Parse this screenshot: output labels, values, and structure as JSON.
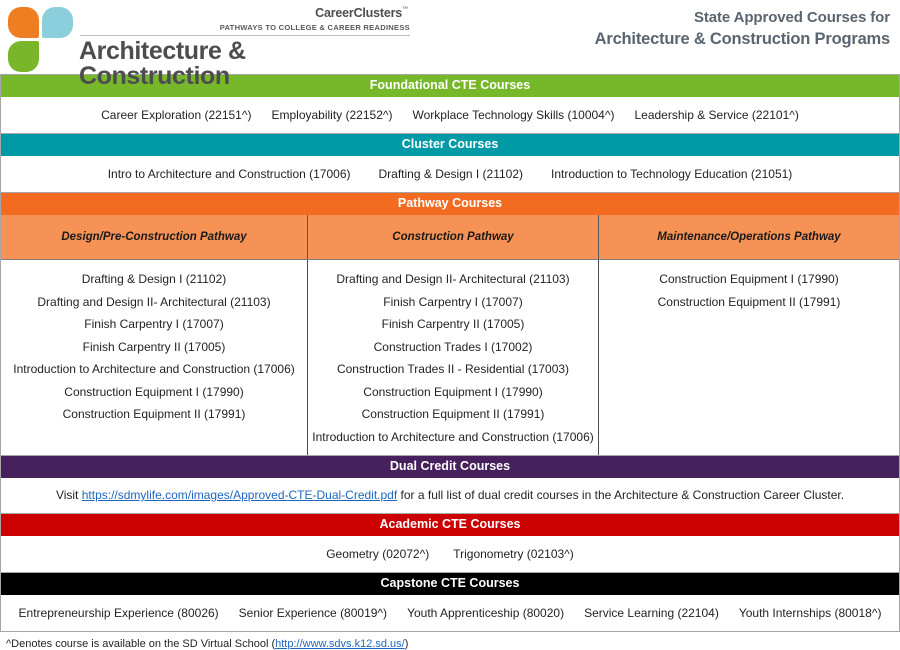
{
  "header": {
    "brand_name": "CareerClusters",
    "brand_tm": "™",
    "brand_tagline": "PATHWAYS TO COLLEGE & CAREER READINESS",
    "cluster_line1": "Architecture &",
    "cluster_line2": "Construction",
    "title_line1": "State Approved Courses for",
    "title_line2": "Architecture & Construction Programs",
    "logo_colors": {
      "orange": "#ef7d22",
      "light_blue": "#8ccfdc",
      "green": "#7ab629"
    }
  },
  "sections": {
    "foundational": {
      "title": "Foundational CTE Courses",
      "color": "#76b82a",
      "courses": [
        "Career Exploration (22151^)",
        "Employability (22152^)",
        "Workplace Technology Skills (10004^)",
        "Leadership & Service (22101^)"
      ]
    },
    "cluster": {
      "title": "Cluster Courses",
      "color": "#009aa6",
      "courses": [
        "Intro to Architecture and Construction (17006)",
        "Drafting & Design I (21102)",
        "Introduction to Technology Education (21051)"
      ]
    },
    "pathway": {
      "title": "Pathway Courses",
      "color": "#f26b21",
      "subheader_color": "#f79256",
      "columns": [
        {
          "label": "Design/Pre-Construction Pathway",
          "courses": [
            "Drafting & Design I (21102)",
            "Drafting and Design II- Architectural (21103)",
            "Finish Carpentry I (17007)",
            "Finish Carpentry II (17005)",
            "Introduction to Architecture and Construction (17006)",
            "Construction Equipment I (17990)",
            "Construction Equipment II (17991)"
          ]
        },
        {
          "label": "Construction Pathway",
          "courses": [
            "Drafting and Design II- Architectural (21103)",
            "Finish Carpentry I (17007)",
            "Finish Carpentry II (17005)",
            "Construction Trades I (17002)",
            "Construction Trades II - Residential (17003)",
            "Construction Equipment I (17990)",
            "Construction Equipment II (17991)",
            "Introduction to Architecture and Construction (17006)"
          ]
        },
        {
          "label": "Maintenance/Operations Pathway",
          "courses": [
            "Construction Equipment I (17990)",
            "Construction Equipment II (17991)"
          ]
        }
      ]
    },
    "dual_credit": {
      "title": "Dual Credit Courses",
      "color": "#46215e",
      "text_before": "Visit ",
      "link_text": "https://sdmylife.com/images/Approved-CTE-Dual-Credit.pdf",
      "text_after": " for a full list of dual credit courses in the Architecture & Construction Career Cluster."
    },
    "academic": {
      "title": "Academic CTE Courses",
      "color": "#cc0000",
      "courses": [
        "Geometry (02072^)",
        "Trigonometry (02103^)"
      ]
    },
    "capstone": {
      "title": "Capstone CTE Courses",
      "color": "#000000",
      "courses": [
        "Entrepreneurship Experience (80026)",
        "Senior Experience (80019^)",
        "Youth Apprenticeship (80020)",
        "Service Learning (22104)",
        "Youth Internships (80018^)"
      ]
    }
  },
  "footnote": {
    "text_before": "^Denotes course is available on the SD Virtual School (",
    "link_text": "http://www.sdvs.k12.sd.us/",
    "text_after": ")"
  }
}
